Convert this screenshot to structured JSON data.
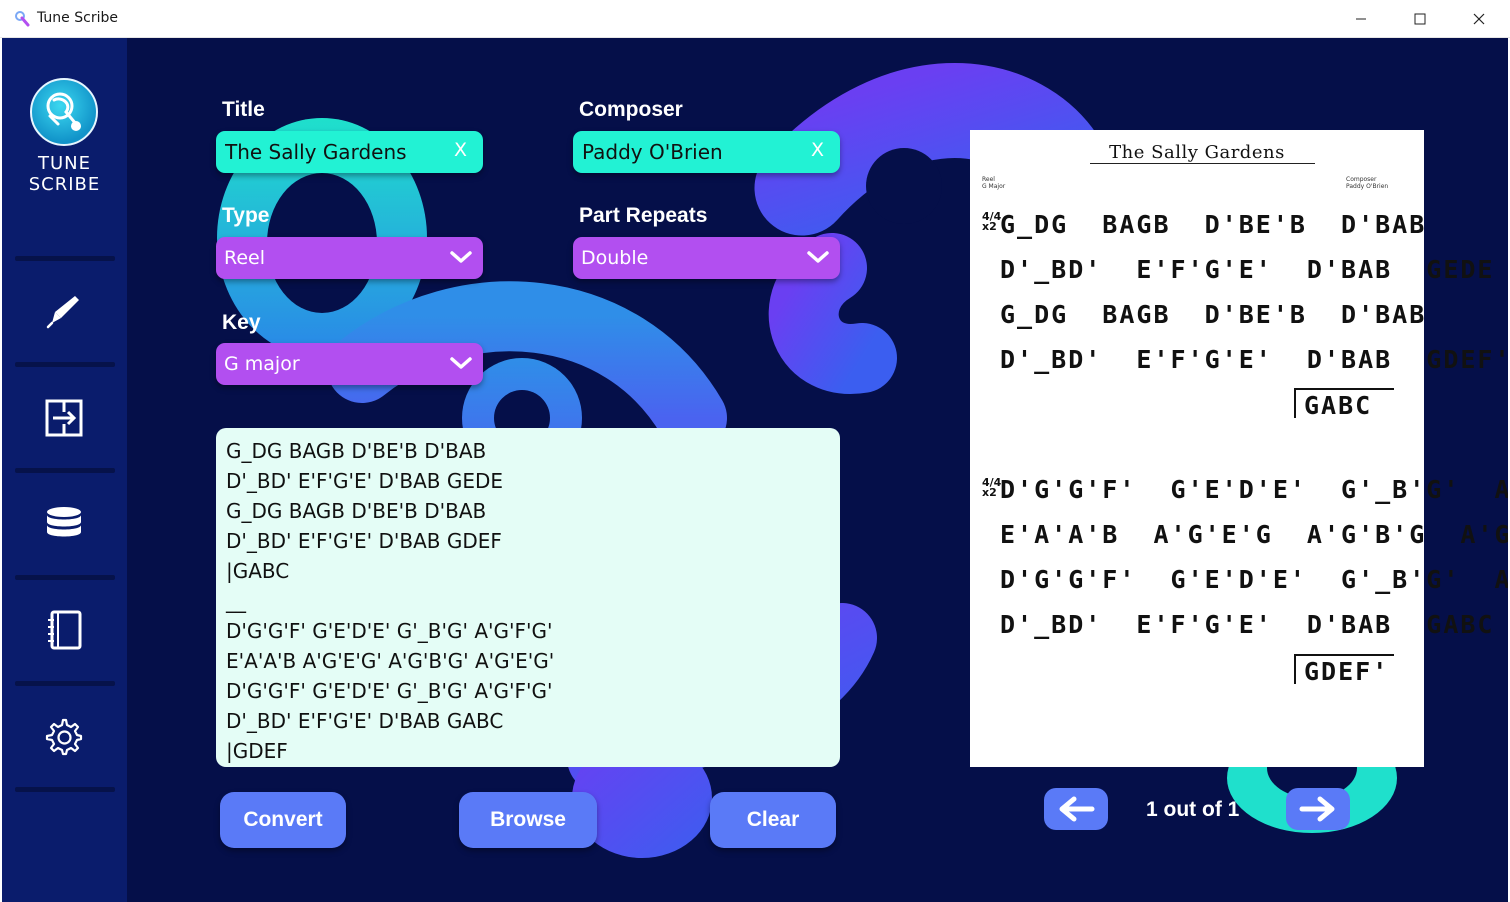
{
  "window": {
    "title": "Tune Scribe"
  },
  "sidebar": {
    "logo_text_line1": "TUNE",
    "logo_text_line2": "SCRIBE",
    "items": [
      {
        "icon": "pen-icon"
      },
      {
        "icon": "convert-icon"
      },
      {
        "icon": "database-icon"
      },
      {
        "icon": "notebook-icon"
      },
      {
        "icon": "gear-icon"
      }
    ]
  },
  "form": {
    "title_label": "Title",
    "title_value": "The Sally Gardens",
    "composer_label": "Composer",
    "composer_value": "Paddy O'Brien",
    "clear_symbol": "X",
    "type_label": "Type",
    "type_value": "Reel",
    "repeats_label": "Part Repeats",
    "repeats_value": "Double",
    "key_label": "Key",
    "key_value": "G major"
  },
  "notation": {
    "lines": [
      "G_DG BAGB D'BE'B D'BAB",
      "D'_BD' E'F'G'E' D'BAB GEDE",
      "G_DG BAGB D'BE'B D'BAB",
      "D'_BD' E'F'G'E' D'BAB GDEF",
      "|GABC",
      "__",
      "D'G'G'F' G'E'D'E' G'_B'G' A'G'F'G'",
      "E'A'A'B A'G'E'G' A'G'B'G' A'G'E'G'",
      "D'G'G'F' G'E'D'E' G'_B'G' A'G'F'G'",
      "D'_BD' E'F'G'E' D'BAB GABC",
      "|GDEF"
    ]
  },
  "actions": {
    "convert_label": "Convert",
    "browse_label": "Browse",
    "clear_label": "Clear"
  },
  "sheet": {
    "title": "The Sally Gardens",
    "meta_left_1": "Reel",
    "meta_left_2": "G Major",
    "meta_right_1": "Composer",
    "meta_right_2": "Paddy O'Brien",
    "time_sig_top": "4/4",
    "time_sig_bottom": "x2",
    "part_a": [
      "G_DG  BAGB  D'BE'B  D'BAB",
      "D'_BD'  E'F'G'E'  D'BAB  GEDE",
      "G_DG  BAGB  D'BE'B  D'BAB",
      "D'_BD'  E'F'G'E'  D'BAB  GDEF'"
    ],
    "part_a_volta": "GABC",
    "part_b": [
      "D'G'G'F'  G'E'D'E'  G'_B'G'  A'G'F'G'",
      "E'A'A'B  A'G'E'G  A'G'B'G  A'G'E'G",
      "D'G'G'F'  G'E'D'E'  G'_B'G'  A'G'F'G'",
      "D'_BD'  E'F'G'E'  D'BAB  GABC"
    ],
    "part_b_volta": "GDEF'"
  },
  "pagination": {
    "label": "1 out of 1"
  },
  "colors": {
    "background": "#050f49",
    "sidebar": "#0a1c6c",
    "text_field": "#22f2d4",
    "select_field": "#b24ff0",
    "button": "#5a7af7",
    "notation_bg": "#e4fdf6"
  }
}
